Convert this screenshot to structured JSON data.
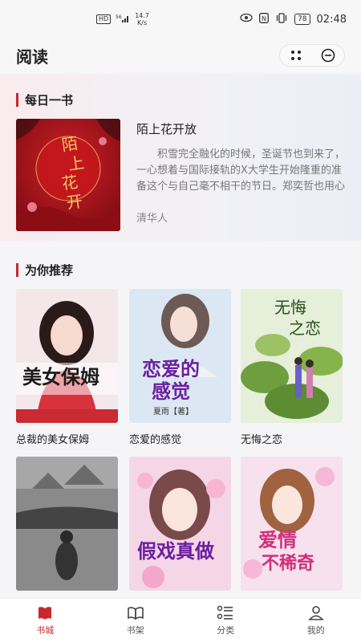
{
  "status_bar": {
    "network_badge": "HD",
    "signal": "56",
    "speed_value": "14.7",
    "speed_unit": "K/s",
    "battery": "78",
    "time": "02:48"
  },
  "header": {
    "title": "阅读"
  },
  "daily": {
    "section_title": "每日一书",
    "book": {
      "title": "陌上花开放",
      "description": "积雪完全融化的时候，圣诞节也到来了，一心想着与国际接轨的X大学生开始隆重的准备这个与自己毫不相干的节日。郑奕哲也用心的...",
      "author": "清华人",
      "cover_text": "陌上花开",
      "cover_color": "#b3141c"
    }
  },
  "recommend": {
    "section_title": "为你推荐",
    "books": [
      {
        "title": "总裁的美女保姆",
        "cover_text": "美女保姆",
        "cover_color": "#e7c8cd"
      },
      {
        "title": "恋爱的感觉",
        "cover_text": "恋爱的感觉",
        "cover_color": "#cfe1ef"
      },
      {
        "title": "无悔之恋",
        "cover_text": "无悔之恋",
        "cover_color": "#cfe3c4"
      },
      {
        "title": "",
        "cover_text": "",
        "cover_color": "#9a9a9a"
      },
      {
        "title": "",
        "cover_text": "假戏真做",
        "cover_color": "#f0c8de"
      },
      {
        "title": "",
        "cover_text": "爱情不稀奇",
        "cover_color": "#f2d3e6"
      }
    ]
  },
  "tabs": [
    {
      "label": "书城",
      "icon": "book-store-icon",
      "active": true
    },
    {
      "label": "书架",
      "icon": "bookshelf-icon",
      "active": false
    },
    {
      "label": "分类",
      "icon": "category-icon",
      "active": false
    },
    {
      "label": "我的",
      "icon": "profile-icon",
      "active": false
    }
  ],
  "colors": {
    "accent": "#c9282d"
  }
}
